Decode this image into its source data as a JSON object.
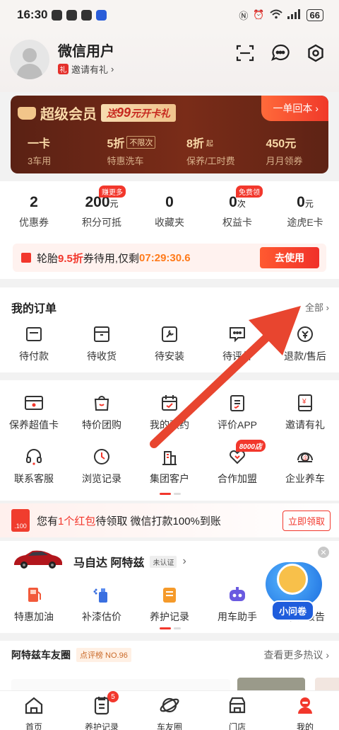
{
  "status": {
    "time": "16:30",
    "battery": "66"
  },
  "profile": {
    "name": "微信用户",
    "invite": "邀请有礼"
  },
  "vip": {
    "title": "超级会员",
    "promo_prefix": "送",
    "promo_amount": "99",
    "promo_suffix": "元开卡礼",
    "button": "一单回本 ›",
    "benefits": [
      {
        "value": "一卡",
        "small": "",
        "tag": "",
        "label": "3车用"
      },
      {
        "value": "5折",
        "small": "",
        "tag": "不限次",
        "label": "特惠洗车"
      },
      {
        "value": "8折",
        "small": "起",
        "tag": "",
        "label": "保养/工时费"
      },
      {
        "value": "450元",
        "small": "",
        "tag": "",
        "label": "月月领券"
      }
    ]
  },
  "stats": [
    {
      "num": "2",
      "unit": "",
      "label": "优惠券",
      "badge": ""
    },
    {
      "num": "200",
      "unit": "元",
      "label": "积分可抵",
      "badge": "赚更多"
    },
    {
      "num": "0",
      "unit": "",
      "label": "收藏夹",
      "badge": ""
    },
    {
      "num": "0",
      "unit": "次",
      "label": "权益卡",
      "badge": "免费领"
    },
    {
      "num": "0",
      "unit": "元",
      "label": "途虎E卡",
      "badge": ""
    }
  ],
  "tire": {
    "prefix": "轮胎",
    "discount": "9.5折",
    "mid": "券待用,仅剩",
    "timer": "07:29:30.6",
    "button": "去使用"
  },
  "orders": {
    "title": "我的订单",
    "all": "全部 ›",
    "items": [
      {
        "label": "待付款",
        "icon": "wallet-icon"
      },
      {
        "label": "待收货",
        "icon": "package-icon"
      },
      {
        "label": "待安装",
        "icon": "wrench-icon"
      },
      {
        "label": "待评价",
        "icon": "comment-icon"
      },
      {
        "label": "退款/售后",
        "icon": "refund-icon"
      }
    ]
  },
  "services": {
    "row1": [
      {
        "label": "保养超值卡",
        "icon": "card-icon"
      },
      {
        "label": "特价团购",
        "icon": "shopping-bag-icon"
      },
      {
        "label": "我的预约",
        "icon": "calendar-icon"
      },
      {
        "label": "评价APP",
        "icon": "clipboard-icon"
      },
      {
        "label": "邀请有礼",
        "icon": "envelope-icon"
      }
    ],
    "row2": [
      {
        "label": "联系客服",
        "icon": "headset-icon"
      },
      {
        "label": "浏览记录",
        "icon": "clock-icon"
      },
      {
        "label": "集团客户",
        "icon": "building-icon"
      },
      {
        "label": "合作加盟",
        "icon": "handshake-icon"
      },
      {
        "label": "企业养车",
        "icon": "enterprise-icon"
      }
    ],
    "join_badge": "8000店"
  },
  "redpacket": {
    "icon_text": ".100",
    "pre": "您有",
    "count": "1个红包",
    "post": "待领取 微信打款100%到账",
    "button": "立即领取"
  },
  "car": {
    "name": "马自达 阿特兹",
    "verify": "未认证",
    "items": [
      {
        "label": "特惠加油",
        "icon": "fuel-icon"
      },
      {
        "label": "补漆估价",
        "icon": "spray-icon"
      },
      {
        "label": "养护记录",
        "icon": "record-icon"
      },
      {
        "label": "用车助手",
        "icon": "robot-icon"
      },
      {
        "label": "车况报告",
        "icon": "report-icon"
      }
    ],
    "float_label": "小问卷"
  },
  "circle": {
    "title": "阿特兹车友圈",
    "rank": "点评榜 NO.96",
    "more": "查看更多热议 ›"
  },
  "tabs": [
    {
      "label": "首页",
      "icon": "home-icon",
      "badge": ""
    },
    {
      "label": "养护记录",
      "icon": "maintenance-icon",
      "badge": "5"
    },
    {
      "label": "车友圈",
      "icon": "planet-icon",
      "badge": ""
    },
    {
      "label": "门店",
      "icon": "store-icon",
      "badge": ""
    },
    {
      "label": "我的",
      "icon": "profile-icon",
      "badge": ""
    }
  ],
  "colors": {
    "accent": "#f2372c",
    "vip_bg": "#6a2616",
    "vip_text": "#f9d9a8"
  }
}
